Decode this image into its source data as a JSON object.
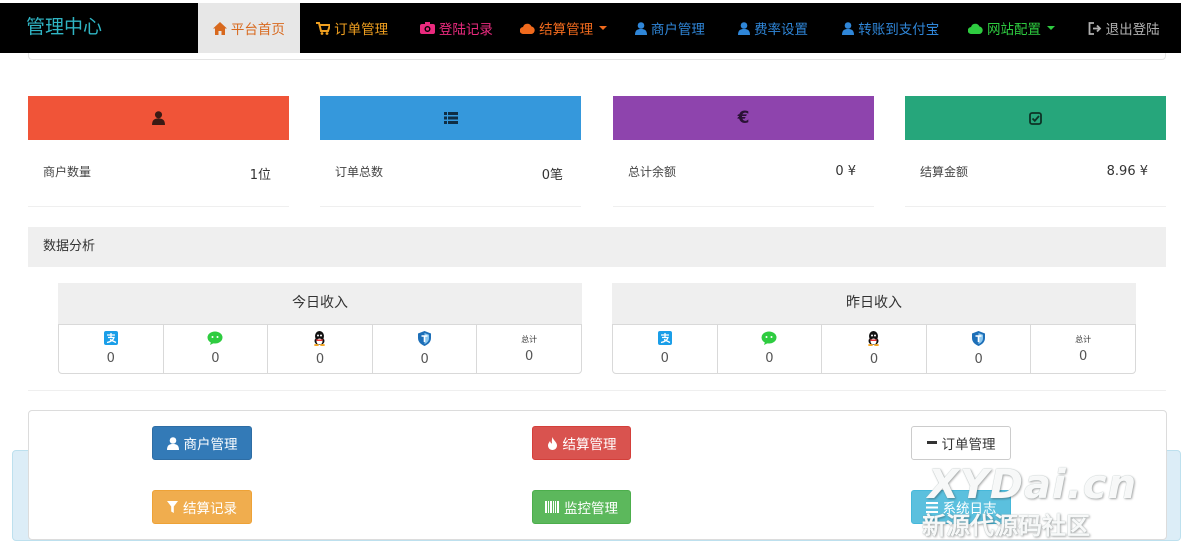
{
  "brand": "管理中心",
  "nav": [
    {
      "label": "平台首页",
      "icon": "home-icon",
      "color": "#d8691e"
    },
    {
      "label": "订单管理",
      "icon": "cart-icon",
      "color": "#f0a020"
    },
    {
      "label": "登陆记录",
      "icon": "camera-icon",
      "color": "#ea2a7e"
    },
    {
      "label": "结算管理",
      "icon": "cloud-icon",
      "color": "#f06a1d"
    },
    {
      "label": "商户管理",
      "icon": "user-icon",
      "color": "#2f86d8"
    },
    {
      "label": "费率设置",
      "icon": "user-icon",
      "color": "#2f86d8"
    },
    {
      "label": "转账到支付宝",
      "icon": "user-icon",
      "color": "#2f86d8"
    },
    {
      "label": "网站配置",
      "icon": "cloud-icon",
      "color": "#2ecc40"
    },
    {
      "label": "退出登陆",
      "icon": "logout-icon",
      "color": "#b0b0b0"
    }
  ],
  "stats": [
    {
      "label": "商户数量",
      "value": "1位",
      "color": "#f05438",
      "icon": "user-icon"
    },
    {
      "label": "订单总数",
      "value": "0笔",
      "color": "#3598dc",
      "icon": "list-icon"
    },
    {
      "label": "总计余额",
      "value": "0 ¥",
      "color": "#8e44ad",
      "icon": "euro-icon"
    },
    {
      "label": "结算金额",
      "value": "8.96 ¥",
      "color": "#26a67b",
      "icon": "check-square-icon"
    }
  ],
  "analysis_title": "数据分析",
  "today": {
    "title": "今日收入",
    "values": [
      "0",
      "0",
      "0",
      "0",
      "0"
    ]
  },
  "yesterday": {
    "title": "昨日收入",
    "values": [
      "0",
      "0",
      "0",
      "0",
      "0"
    ]
  },
  "total_label": "总计",
  "channels": [
    "alipay-icon",
    "wechat-icon",
    "qq-icon",
    "shield-icon",
    "total-label"
  ],
  "buttons": {
    "merchant": {
      "label": "商户管理",
      "color": "#337ab7"
    },
    "settle": {
      "label": "结算管理",
      "color": "#d9534f"
    },
    "orders": {
      "label": "订单管理",
      "color": "#ffffff"
    },
    "settle_log": {
      "label": "结算记录",
      "color": "#f0ad4e"
    },
    "monitor": {
      "label": "监控管理",
      "color": "#5cb85c"
    },
    "system": {
      "label": "系统日志",
      "color": "#5bc0de"
    }
  },
  "watermark": {
    "top": "XYDai.cn",
    "bottom": "新源代源码社区"
  }
}
